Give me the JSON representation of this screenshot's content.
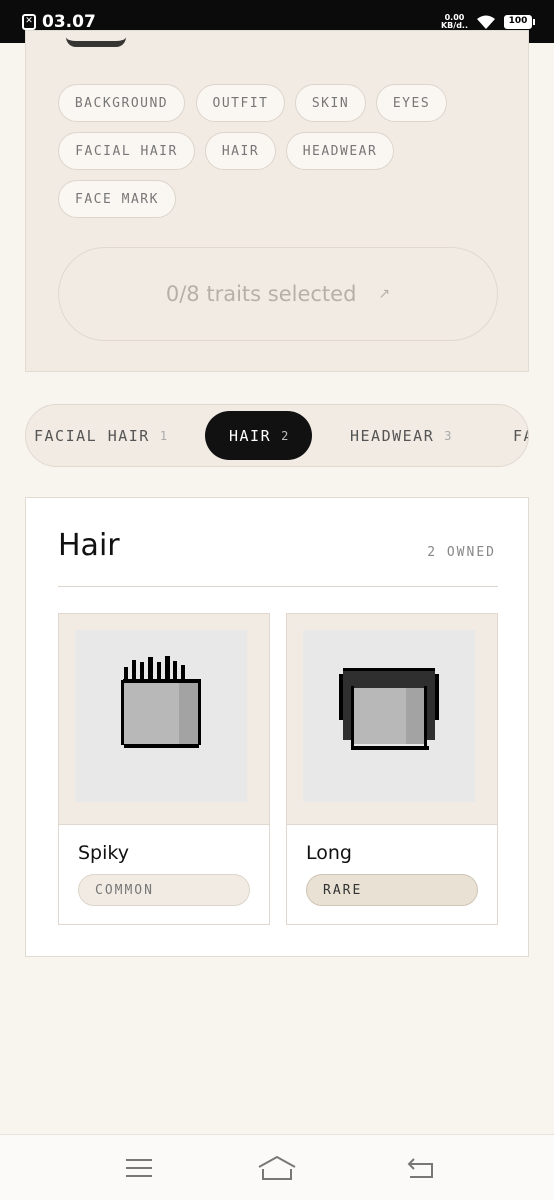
{
  "status_bar": {
    "time": "03.07",
    "net_speed_value": "0.00",
    "net_speed_unit": "KB/d..",
    "battery": "100",
    "icons": [
      "notification-icon",
      "wifi-icon",
      "battery-icon"
    ]
  },
  "trait_filter": {
    "chips": [
      "BACKGROUND",
      "OUTFIT",
      "SKIN",
      "EYES",
      "FACIAL HAIR",
      "HAIR",
      "HEADWEAR",
      "FACE MARK"
    ],
    "selected_label": "0/8 traits selected",
    "arrow_icon": "arrow-up-right-icon"
  },
  "category_tabs": [
    {
      "label": "FACIAL HAIR",
      "count": "1"
    },
    {
      "label": "HAIR",
      "count": "2",
      "active": true
    },
    {
      "label": "HEADWEAR",
      "count": "3"
    },
    {
      "label": "FA",
      "count": ""
    }
  ],
  "hair_section": {
    "title": "Hair",
    "owned": "2 OWNED",
    "items": [
      {
        "name": "Spiky",
        "rarity": "COMMON",
        "icon": "spiky-hair-icon"
      },
      {
        "name": "Long",
        "rarity": "RARE",
        "icon": "long-hair-icon"
      }
    ]
  },
  "bottom_nav": [
    "menu-icon",
    "home-icon",
    "back-icon"
  ],
  "colors": {
    "page_bg": "#f8f4ee",
    "card_bg": "#f1ebe4",
    "active_tab": "#111111",
    "status_bar": "#0b0b0b"
  }
}
